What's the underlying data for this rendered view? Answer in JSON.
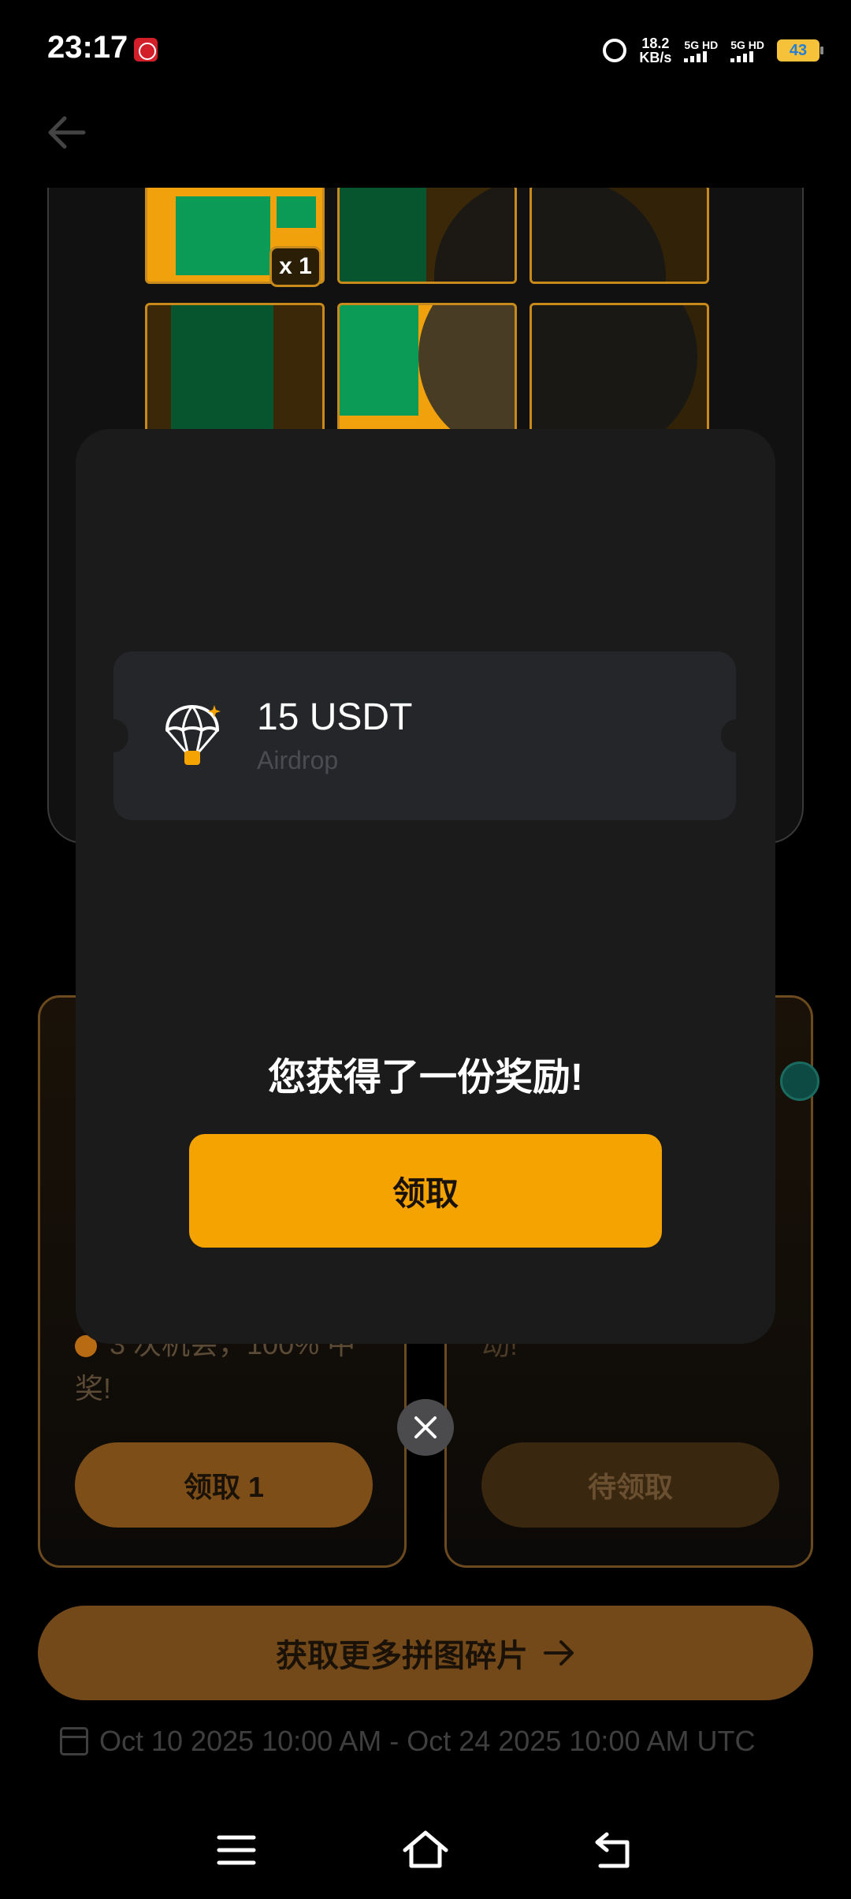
{
  "status_bar": {
    "time": "23:17",
    "net_speed_value": "18.2",
    "net_speed_unit": "KB/s",
    "sim1": "5G HD",
    "sim2": "5G HD",
    "battery": "43"
  },
  "puzzle": {
    "piece_count": "x 1"
  },
  "cards": {
    "left_text": "3 次机会，100% 中奖!",
    "left_button": "领取 1",
    "right_text": "动!",
    "right_button": "待领取"
  },
  "more_button": "获取更多拼图碎片",
  "date_range": "Oct 10 2025 10:00 AM - Oct 24 2025 10:00 AM UTC",
  "modal": {
    "reward_amount": "15 USDT",
    "reward_type": "Airdrop",
    "title": "您获得了一份奖励!",
    "claim_button": "领取"
  },
  "colors": {
    "accent": "#f4a300",
    "modal_bg": "#1b1b1b",
    "ticket_bg": "#25262a"
  },
  "icons": [
    "back-arrow-icon",
    "alarm-icon",
    "calendar-icon",
    "parachute-icon",
    "close-icon",
    "arrow-right-icon",
    "menu-icon",
    "home-icon",
    "nav-back-icon"
  ]
}
